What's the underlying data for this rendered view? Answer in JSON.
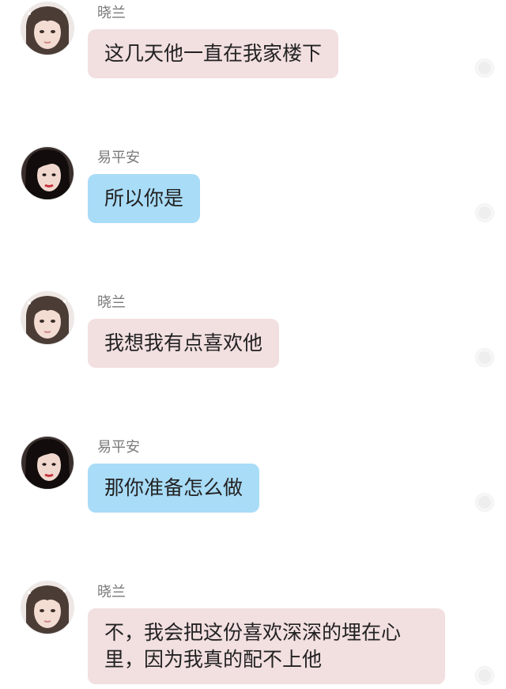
{
  "conversation": {
    "messages": [
      {
        "sender": "晓兰",
        "text": "这几天他一直在我家楼下",
        "style": "pink"
      },
      {
        "sender": "易平安",
        "text": "所以你是",
        "style": "blue"
      },
      {
        "sender": "晓兰",
        "text": "我想我有点喜欢他",
        "style": "pink"
      },
      {
        "sender": "易平安",
        "text": "那你准备怎么做",
        "style": "blue"
      },
      {
        "sender": "晓兰",
        "text": "不，我会把这份喜欢深深的埋在心里，因为我真的配不上他",
        "style": "pink"
      }
    ]
  },
  "colors": {
    "pink_bubble": "#f2dfe0",
    "blue_bubble": "#a9dcf7",
    "sender_name": "#7a7a7a",
    "message_text": "#222222"
  },
  "icons": {
    "avatar_xiaolan": "girl-face-light-avatar",
    "avatar_yipingan": "girl-face-dark-hair-avatar",
    "read_indicator": "circle-dot-icon"
  }
}
